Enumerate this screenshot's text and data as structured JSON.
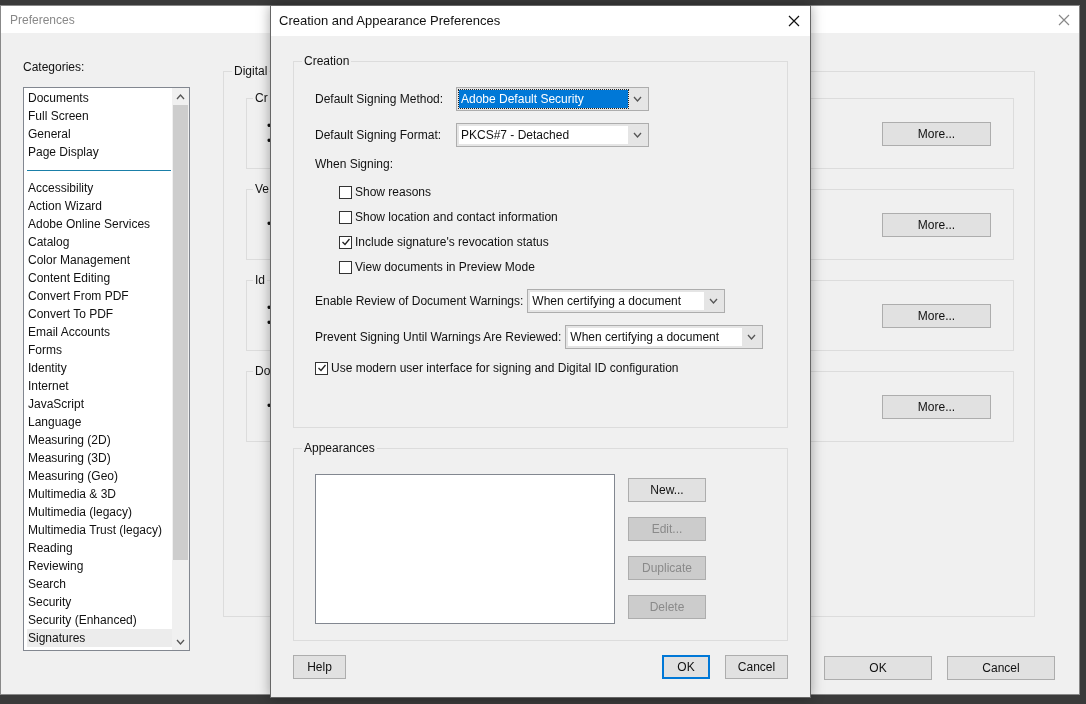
{
  "main_window": {
    "title": "Preferences",
    "categories_label": "Categories:",
    "categories": [
      {
        "kind": "item",
        "label": "Documents",
        "selected": false
      },
      {
        "kind": "item",
        "label": "Full Screen",
        "selected": false
      },
      {
        "kind": "item",
        "label": "General",
        "selected": false
      },
      {
        "kind": "item",
        "label": "Page Display",
        "selected": false
      },
      {
        "kind": "separator"
      },
      {
        "kind": "item",
        "label": "Accessibility",
        "selected": false
      },
      {
        "kind": "item",
        "label": "Action Wizard",
        "selected": false
      },
      {
        "kind": "item",
        "label": "Adobe Online Services",
        "selected": false
      },
      {
        "kind": "item",
        "label": "Catalog",
        "selected": false
      },
      {
        "kind": "item",
        "label": "Color Management",
        "selected": false
      },
      {
        "kind": "item",
        "label": "Content Editing",
        "selected": false
      },
      {
        "kind": "item",
        "label": "Convert From PDF",
        "selected": false
      },
      {
        "kind": "item",
        "label": "Convert To PDF",
        "selected": false
      },
      {
        "kind": "item",
        "label": "Email Accounts",
        "selected": false
      },
      {
        "kind": "item",
        "label": "Forms",
        "selected": false
      },
      {
        "kind": "item",
        "label": "Identity",
        "selected": false
      },
      {
        "kind": "item",
        "label": "Internet",
        "selected": false
      },
      {
        "kind": "item",
        "label": "JavaScript",
        "selected": false
      },
      {
        "kind": "item",
        "label": "Language",
        "selected": false
      },
      {
        "kind": "item",
        "label": "Measuring (2D)",
        "selected": false
      },
      {
        "kind": "item",
        "label": "Measuring (3D)",
        "selected": false
      },
      {
        "kind": "item",
        "label": "Measuring (Geo)",
        "selected": false
      },
      {
        "kind": "item",
        "label": "Multimedia & 3D",
        "selected": false
      },
      {
        "kind": "item",
        "label": "Multimedia (legacy)",
        "selected": false
      },
      {
        "kind": "item",
        "label": "Multimedia Trust (legacy)",
        "selected": false
      },
      {
        "kind": "item",
        "label": "Reading",
        "selected": false
      },
      {
        "kind": "item",
        "label": "Reviewing",
        "selected": false
      },
      {
        "kind": "item",
        "label": "Search",
        "selected": false
      },
      {
        "kind": "item",
        "label": "Security",
        "selected": false
      },
      {
        "kind": "item",
        "label": "Security (Enhanced)",
        "selected": false
      },
      {
        "kind": "item",
        "label": "Signatures",
        "selected": true
      }
    ],
    "panel": {
      "title": "Digital",
      "groups": [
        {
          "title": "Cr",
          "bullets": [
            "•",
            "•"
          ],
          "button": "More..."
        },
        {
          "title": "Ve",
          "bullets": [
            "•"
          ],
          "button": "More..."
        },
        {
          "title": "Id",
          "bullets": [
            "•",
            "•"
          ],
          "button": "More..."
        },
        {
          "title": "Do",
          "bullets": [
            "•"
          ],
          "button": "More..."
        }
      ]
    },
    "buttons": [
      "OK",
      "Cancel"
    ]
  },
  "dialog": {
    "title": "Creation and Appearance Preferences",
    "creation": {
      "title": "Creation",
      "fields": [
        {
          "label": "Default Signing Method:",
          "value": "Adobe Default Security",
          "focused": true
        },
        {
          "label": "Default Signing Format:",
          "value": "PKCS#7 - Detached",
          "focused": false
        }
      ],
      "when_signing": "When Signing:",
      "options": [
        {
          "label": "Show reasons",
          "checked": false
        },
        {
          "label": "Show location and contact information",
          "checked": false
        },
        {
          "label": "Include signature's revocation status",
          "checked": true
        },
        {
          "label": "View documents in Preview Mode",
          "checked": false
        }
      ],
      "warning_fields": [
        {
          "label": "Enable Review of Document Warnings:",
          "value": "When certifying a document"
        },
        {
          "label": "Prevent Signing Until Warnings Are Reviewed:",
          "value": "When certifying a document"
        }
      ],
      "modern_ui": {
        "label": "Use modern user interface for signing and Digital ID configuration",
        "checked": true
      }
    },
    "appearances": {
      "title": "Appearances",
      "buttons": [
        {
          "label": "New...",
          "disabled": false
        },
        {
          "label": "Edit...",
          "disabled": true
        },
        {
          "label": "Duplicate",
          "disabled": true
        },
        {
          "label": "Delete",
          "disabled": true
        }
      ]
    },
    "buttons": [
      {
        "label": "Help",
        "default": false
      },
      {
        "label": "OK",
        "default": true
      },
      {
        "label": "Cancel",
        "default": false
      }
    ]
  }
}
